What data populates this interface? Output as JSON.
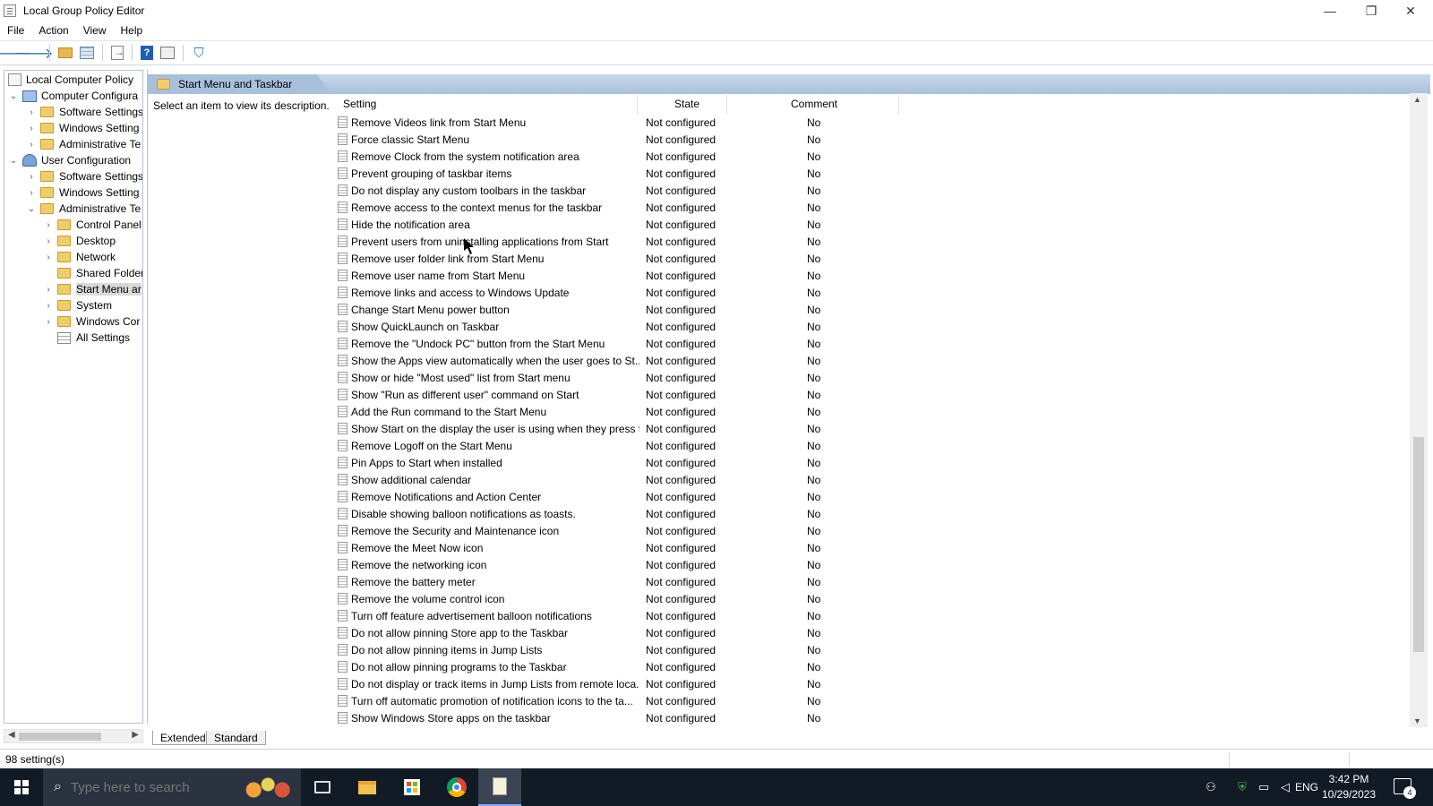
{
  "window": {
    "title": "Local Group Policy Editor",
    "minimize": "—",
    "restore": "❐",
    "close": "✕"
  },
  "menu": [
    "File",
    "Action",
    "View",
    "Help"
  ],
  "toolbar": {
    "back": "🡐",
    "forward": "🡒",
    "help": "?",
    "filter": "⛉"
  },
  "tree": {
    "root": "Local Computer Policy",
    "computer_config": "Computer Configura",
    "cc_software": "Software Settings",
    "cc_windows": "Windows Setting",
    "cc_admin": "Administrative Te",
    "user_config": "User Configuration",
    "uc_software": "Software Settings",
    "uc_windows": "Windows Setting",
    "uc_admin": "Administrative Te",
    "control_panel": "Control Panel",
    "desktop": "Desktop",
    "network": "Network",
    "shared_folders": "Shared Folder",
    "start_menu": "Start Menu ar",
    "system": "System",
    "windows_components": "Windows Cor",
    "all_settings": "All Settings"
  },
  "pane": {
    "title": "Start Menu and Taskbar",
    "description": "Select an item to view its description.",
    "col_setting": "Setting",
    "col_state": "State",
    "col_comment": "Comment"
  },
  "rows": [
    {
      "name": "Remove Videos link from Start Menu",
      "state": "Not configured",
      "comment": "No"
    },
    {
      "name": "Force classic Start Menu",
      "state": "Not configured",
      "comment": "No"
    },
    {
      "name": "Remove Clock from the system notification area",
      "state": "Not configured",
      "comment": "No"
    },
    {
      "name": "Prevent grouping of taskbar items",
      "state": "Not configured",
      "comment": "No"
    },
    {
      "name": "Do not display any custom toolbars in the taskbar",
      "state": "Not configured",
      "comment": "No"
    },
    {
      "name": "Remove access to the context menus for the taskbar",
      "state": "Not configured",
      "comment": "No"
    },
    {
      "name": "Hide the notification area",
      "state": "Not configured",
      "comment": "No"
    },
    {
      "name": "Prevent users from uninstalling applications from Start",
      "state": "Not configured",
      "comment": "No"
    },
    {
      "name": "Remove user folder link from Start Menu",
      "state": "Not configured",
      "comment": "No"
    },
    {
      "name": "Remove user name from Start Menu",
      "state": "Not configured",
      "comment": "No"
    },
    {
      "name": "Remove links and access to Windows Update",
      "state": "Not configured",
      "comment": "No"
    },
    {
      "name": "Change Start Menu power button",
      "state": "Not configured",
      "comment": "No"
    },
    {
      "name": "Show QuickLaunch on Taskbar",
      "state": "Not configured",
      "comment": "No"
    },
    {
      "name": "Remove the \"Undock PC\" button from the Start Menu",
      "state": "Not configured",
      "comment": "No"
    },
    {
      "name": "Show the Apps view automatically when the user goes to St...",
      "state": "Not configured",
      "comment": "No"
    },
    {
      "name": "Show or hide \"Most used\" list from Start menu",
      "state": "Not configured",
      "comment": "No"
    },
    {
      "name": "Show \"Run as different user\" command on Start",
      "state": "Not configured",
      "comment": "No"
    },
    {
      "name": "Add the Run command to the Start Menu",
      "state": "Not configured",
      "comment": "No"
    },
    {
      "name": "Show Start on the display the user is using when they press t...",
      "state": "Not configured",
      "comment": "No"
    },
    {
      "name": "Remove Logoff on the Start Menu",
      "state": "Not configured",
      "comment": "No"
    },
    {
      "name": "Pin Apps to Start when installed",
      "state": "Not configured",
      "comment": "No"
    },
    {
      "name": "Show additional calendar",
      "state": "Not configured",
      "comment": "No"
    },
    {
      "name": "Remove Notifications and Action Center",
      "state": "Not configured",
      "comment": "No"
    },
    {
      "name": "Disable showing balloon notifications as toasts.",
      "state": "Not configured",
      "comment": "No"
    },
    {
      "name": "Remove the Security and Maintenance icon",
      "state": "Not configured",
      "comment": "No"
    },
    {
      "name": "Remove the Meet Now icon",
      "state": "Not configured",
      "comment": "No"
    },
    {
      "name": "Remove the networking icon",
      "state": "Not configured",
      "comment": "No"
    },
    {
      "name": "Remove the battery meter",
      "state": "Not configured",
      "comment": "No"
    },
    {
      "name": "Remove the volume control icon",
      "state": "Not configured",
      "comment": "No"
    },
    {
      "name": "Turn off feature advertisement balloon notifications",
      "state": "Not configured",
      "comment": "No"
    },
    {
      "name": "Do not allow pinning Store app to the Taskbar",
      "state": "Not configured",
      "comment": "No"
    },
    {
      "name": "Do not allow pinning items in Jump Lists",
      "state": "Not configured",
      "comment": "No"
    },
    {
      "name": "Do not allow pinning programs to the Taskbar",
      "state": "Not configured",
      "comment": "No"
    },
    {
      "name": "Do not display or track items in Jump Lists from remote loca...",
      "state": "Not configured",
      "comment": "No"
    },
    {
      "name": "Turn off automatic promotion of notification icons to the ta...",
      "state": "Not configured",
      "comment": "No"
    },
    {
      "name": "Show Windows Store apps on the taskbar",
      "state": "Not configured",
      "comment": "No"
    }
  ],
  "tabs": {
    "extended": "Extended",
    "standard": "Standard"
  },
  "status": {
    "count": "98 setting(s)"
  },
  "taskbar": {
    "search_placeholder": "Type here to search",
    "language": "ENG",
    "time": "3:42 PM",
    "date": "10/29/2023",
    "notification_count": "4"
  }
}
